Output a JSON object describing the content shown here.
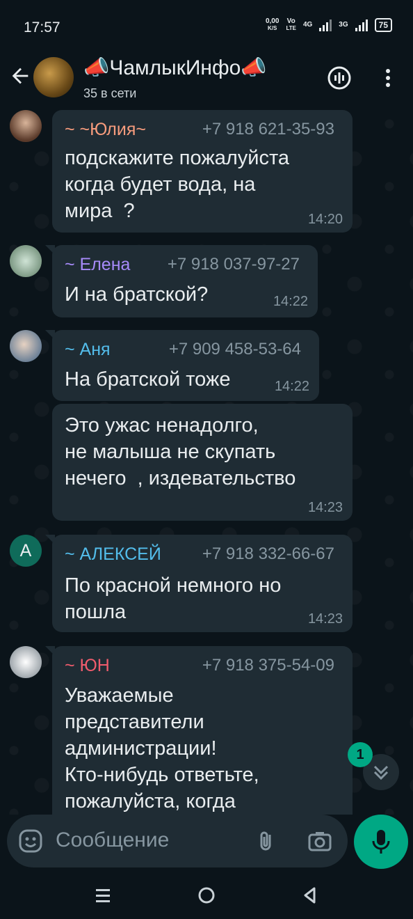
{
  "status_bar": {
    "time": "17:57",
    "net_speed_top": "0,00",
    "net_speed_bottom": "K/S",
    "volte_top": "Vo",
    "volte_bottom": "LTE",
    "net1": "4G",
    "net2": "3G",
    "battery": "75"
  },
  "header": {
    "title": "📣ЧамлыкИнфо📣",
    "subtitle": "35 в сети"
  },
  "messages": [
    {
      "sender": "~ ~Юлия~",
      "sender_color": "#f79c7d",
      "phone": "+7 918 621-35-93",
      "lines": "подскажите пожалуйста\nкогда будет вода, на\nмира  ?",
      "time": "14:20"
    },
    {
      "sender": "~ Елена",
      "sender_color": "#a78bfa",
      "phone": "+7 918 037-97-27",
      "lines": "И на братской?",
      "time": "14:22"
    },
    {
      "sender": "~ Аня",
      "sender_color": "#53bdeb",
      "phone": "+7 909 458-53-64",
      "lines": "На братской тоже",
      "time": "14:22"
    },
    {
      "sender": "",
      "sender_color": "",
      "phone": "",
      "lines": "Это ужас ненадолго,\nне малыша не скупать\nнечего  , издевательство",
      "time": "14:23"
    },
    {
      "sender": "~ АЛЕКСЕЙ",
      "sender_color": "#53bdeb",
      "phone": "+7 918 332-66-67",
      "lines": "По красной немного но\nпошла",
      "time": "14:23"
    },
    {
      "sender": "~ ЮН",
      "sender_color": "#f15c6d",
      "phone": "+7 918 375-54-09",
      "lines": "Уважаемые\nпредставители\nадминистрации!\nКто-нибудь ответьте,\nпожалуйста, когда",
      "time": ""
    }
  ],
  "avatars": {
    "alexey_letter": "A"
  },
  "unread_badge": "1",
  "composer": {
    "placeholder": "Сообщение"
  },
  "colors": {
    "accent": "#00a884",
    "bubble": "#1f2c34",
    "background": "#0b141a"
  }
}
